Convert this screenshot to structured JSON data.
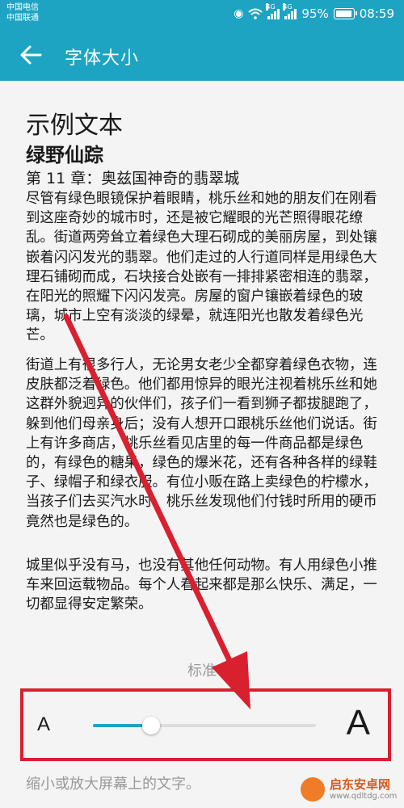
{
  "status_bar": {
    "carrier_1": "中国电信",
    "carrier_2": "中国联通",
    "network_1": "4G",
    "network_2": "4G",
    "battery": "95%",
    "time": "08:59"
  },
  "app_bar": {
    "title": "字体大小",
    "back_icon": "arrow-left-icon"
  },
  "preview": {
    "heading": "示例文本",
    "book_title": "绿野仙踪",
    "chapter": "第 11 章：奥兹国神奇的翡翠城",
    "paragraphs": [
      "尽管有绿色眼镜保护着眼睛，桃乐丝和她的朋友们在刚看到这座奇妙的城市时，还是被它耀眼的光芒照得眼花缭乱。街道两旁耸立着绿色大理石砌成的美丽房屋，到处镶嵌着闪闪发光的翡翠。他们走过的人行道同样是用绿色大理石铺砌而成，石块接合处嵌有一排排紧密相连的翡翠，在阳光的照耀下闪闪发亮。房屋的窗户镶嵌着绿色的玻璃，城市上空有淡淡的绿晕，就连阳光也散发着绿色光芒。",
      "街道上有很多行人，无论男女老少全都穿着绿色衣物，连皮肤都泛着绿色。他们都用惊异的眼光注视着桃乐丝和她这群外貌迥异的伙伴们，孩子们一看到狮子都拔腿跑了，躲到他们母亲身后；没有人想开口跟桃乐丝他们说话。街上有许多商店，桃乐丝看见店里的每一件商品都是绿色的，有绿色的糖果，绿色的爆米花，还有各种各样的绿鞋子、绿帽子和绿衣服。有位小贩在路上卖绿色的柠檬水，当孩子们去买汽水时，桃乐丝发现他们付钱时所用的硬币竟然也是绿色的。",
      "城里似乎没有马，也没有其他任何动物。有人用绿色小推车来回运载物品。每个人看起来都是那么快乐、满足，一切都显得安定繁荣。"
    ]
  },
  "font_size": {
    "current_label": "标准",
    "small_label": "A",
    "large_label": "A",
    "level": 0.26,
    "hint": "缩小或放大屏幕上的文字。"
  },
  "colors": {
    "accent": "#1ea4c3",
    "annotation_red": "#d8202f",
    "secondary_text": "#999999"
  },
  "watermark": {
    "line1": "启东安卓网",
    "line2": "www.qdltdg.com"
  }
}
